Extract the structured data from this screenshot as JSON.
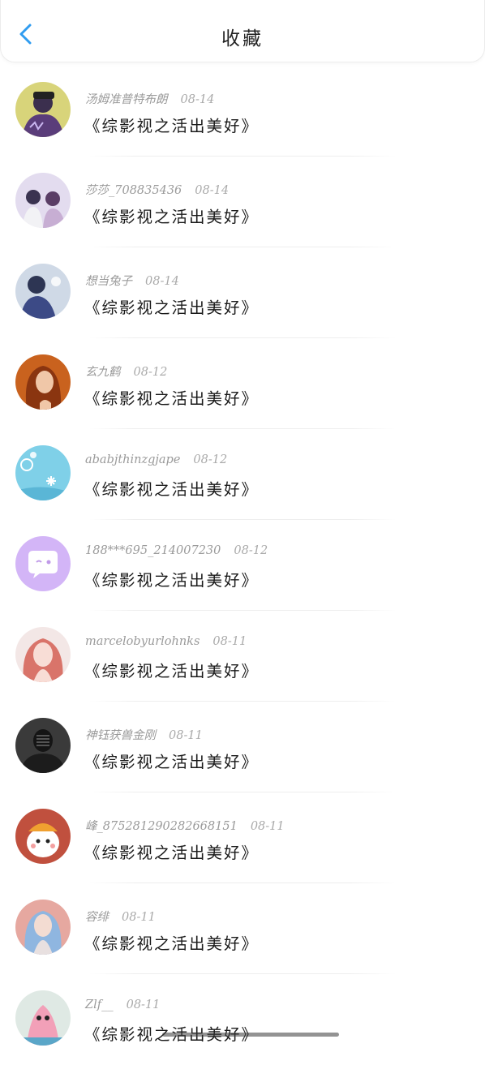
{
  "header": {
    "title": "收藏",
    "back_icon": "chevron-left-icon",
    "accent": "#2f9cf0"
  },
  "favorites": [
    {
      "user": "汤姆准普特布朗",
      "date": "08-14",
      "book": "《综影视之活出美好》",
      "avatar": "avatar-icon"
    },
    {
      "user": "莎莎_708835436",
      "date": "08-14",
      "book": "《综影视之活出美好》",
      "avatar": "avatar-icon"
    },
    {
      "user": "想当兔子",
      "date": "08-14",
      "book": "《综影视之活出美好》",
      "avatar": "avatar-icon"
    },
    {
      "user": "玄九鹤",
      "date": "08-12",
      "book": "《综影视之活出美好》",
      "avatar": "avatar-icon"
    },
    {
      "user": "ababjthinzgjape",
      "date": "08-12",
      "book": "《综影视之活出美好》",
      "avatar": "avatar-icon"
    },
    {
      "user": "188***695_214007230",
      "date": "08-12",
      "book": "《综影视之活出美好》",
      "avatar": "chat-bubble-icon"
    },
    {
      "user": "marcelobyurlohnks",
      "date": "08-11",
      "book": "《综影视之活出美好》",
      "avatar": "avatar-icon"
    },
    {
      "user": "神钰获兽金刚",
      "date": "08-11",
      "book": "《综影视之活出美好》",
      "avatar": "avatar-icon"
    },
    {
      "user": "峰_875281290282668151",
      "date": "08-11",
      "book": "《综影视之活出美好》",
      "avatar": "avatar-icon"
    },
    {
      "user": "容绯",
      "date": "08-11",
      "book": "《综影视之活出美好》",
      "avatar": "avatar-icon"
    },
    {
      "user": "Zlf__",
      "date": "08-11",
      "book": "《综影视之活出美好》",
      "avatar": "avatar-icon"
    }
  ]
}
